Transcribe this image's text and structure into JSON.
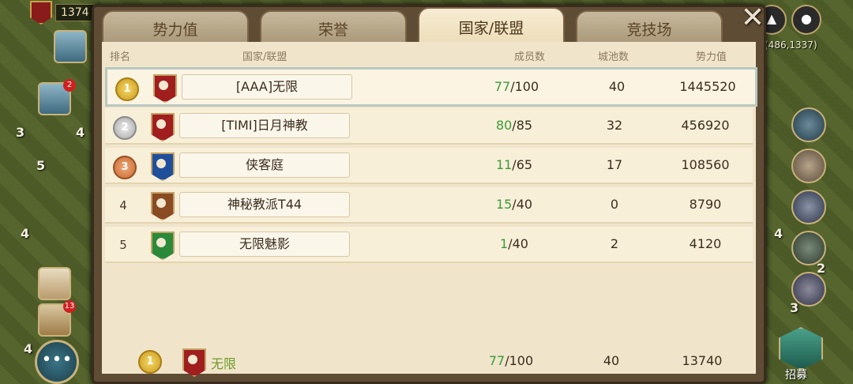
{
  "hud": {
    "resource_value": "1374",
    "sidebar_badge_1": "2",
    "sidebar_badge_2": "13",
    "map_numbers": [
      "3",
      "4",
      "5",
      "4",
      "4",
      "4",
      "2",
      "3"
    ],
    "coords": "(486,1337)",
    "recruit_label": "招募"
  },
  "panel": {
    "tabs": [
      {
        "label": "势力值",
        "active": false
      },
      {
        "label": "荣誉",
        "active": false
      },
      {
        "label": "国家/联盟",
        "active": true
      },
      {
        "label": "竞技场",
        "active": false
      }
    ],
    "close_glyph": "✕",
    "info_glyph": "i",
    "columns": {
      "rank": "排名",
      "name": "国家/联盟",
      "members": "成员数",
      "cities": "城池数",
      "power": "势力值"
    },
    "rows": [
      {
        "rank": "1",
        "medal": "gold",
        "flag_color": "#a01e1e",
        "name": "[AAA]无限",
        "members_current": "77",
        "members_max": "/100",
        "cities": "40",
        "power": "1445520"
      },
      {
        "rank": "2",
        "medal": "silver",
        "flag_color": "#a01e1e",
        "name": "[TIMI]日月神教",
        "members_current": "80",
        "members_max": "/85",
        "cities": "32",
        "power": "456920"
      },
      {
        "rank": "3",
        "medal": "bronze",
        "flag_color": "#1f4f9a",
        "name": "侠客庭",
        "members_current": "11",
        "members_max": "/65",
        "cities": "17",
        "power": "108560"
      },
      {
        "rank": "4",
        "medal": "none",
        "flag_color": "#8a4a22",
        "name": "神秘教派T44",
        "members_current": "15",
        "members_max": "/40",
        "cities": "0",
        "power": "8790"
      },
      {
        "rank": "5",
        "medal": "none",
        "flag_color": "#2a8a3a",
        "name": "无限魅影",
        "members_current": "1",
        "members_max": "/40",
        "cities": "2",
        "power": "4120"
      }
    ],
    "footer": {
      "rank": "1",
      "flag_color": "#a01e1e",
      "name": "无限",
      "members_current": "77",
      "members_max": "/100",
      "cities": "40",
      "power": "13740"
    }
  }
}
